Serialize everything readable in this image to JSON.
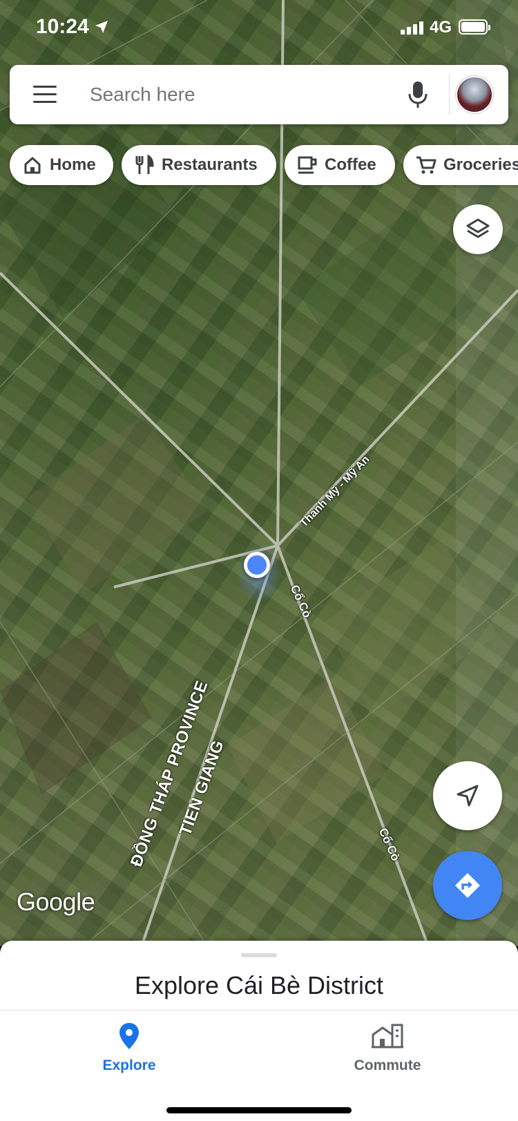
{
  "status_bar": {
    "time": "10:24",
    "network": "4G",
    "icons": [
      "location-arrow-icon",
      "cellular-signal-icon",
      "battery-icon"
    ]
  },
  "search": {
    "placeholder": "Search here",
    "icons": [
      "hamburger-menu-icon",
      "microphone-icon",
      "account-avatar"
    ]
  },
  "chips": [
    {
      "label": "Home",
      "icon": "home-icon"
    },
    {
      "label": "Restaurants",
      "icon": "fork-knife-icon"
    },
    {
      "label": "Coffee",
      "icon": "coffee-cup-icon"
    },
    {
      "label": "Groceries",
      "icon": "shopping-cart-icon"
    }
  ],
  "map": {
    "type": "satellite",
    "labels": {
      "road_thanh_my": "Thanh Mỹ - Mỹ An",
      "road_co_co": "Cổ Cò",
      "province_dong_thap": "ĐỒNG THÁP PROVINCE",
      "province_tien_giang": "TIEN GIANG"
    },
    "logo": "Google",
    "colors": {
      "location_dot": "#4f86f7",
      "accent": "#4285f4"
    }
  },
  "bottom_sheet": {
    "title": "Explore Cái Bè District"
  },
  "nav": {
    "explore": {
      "label": "Explore",
      "icon": "location-pin-icon",
      "active": true
    },
    "commute": {
      "label": "Commute",
      "icon": "commute-buildings-icon",
      "active": false
    }
  }
}
